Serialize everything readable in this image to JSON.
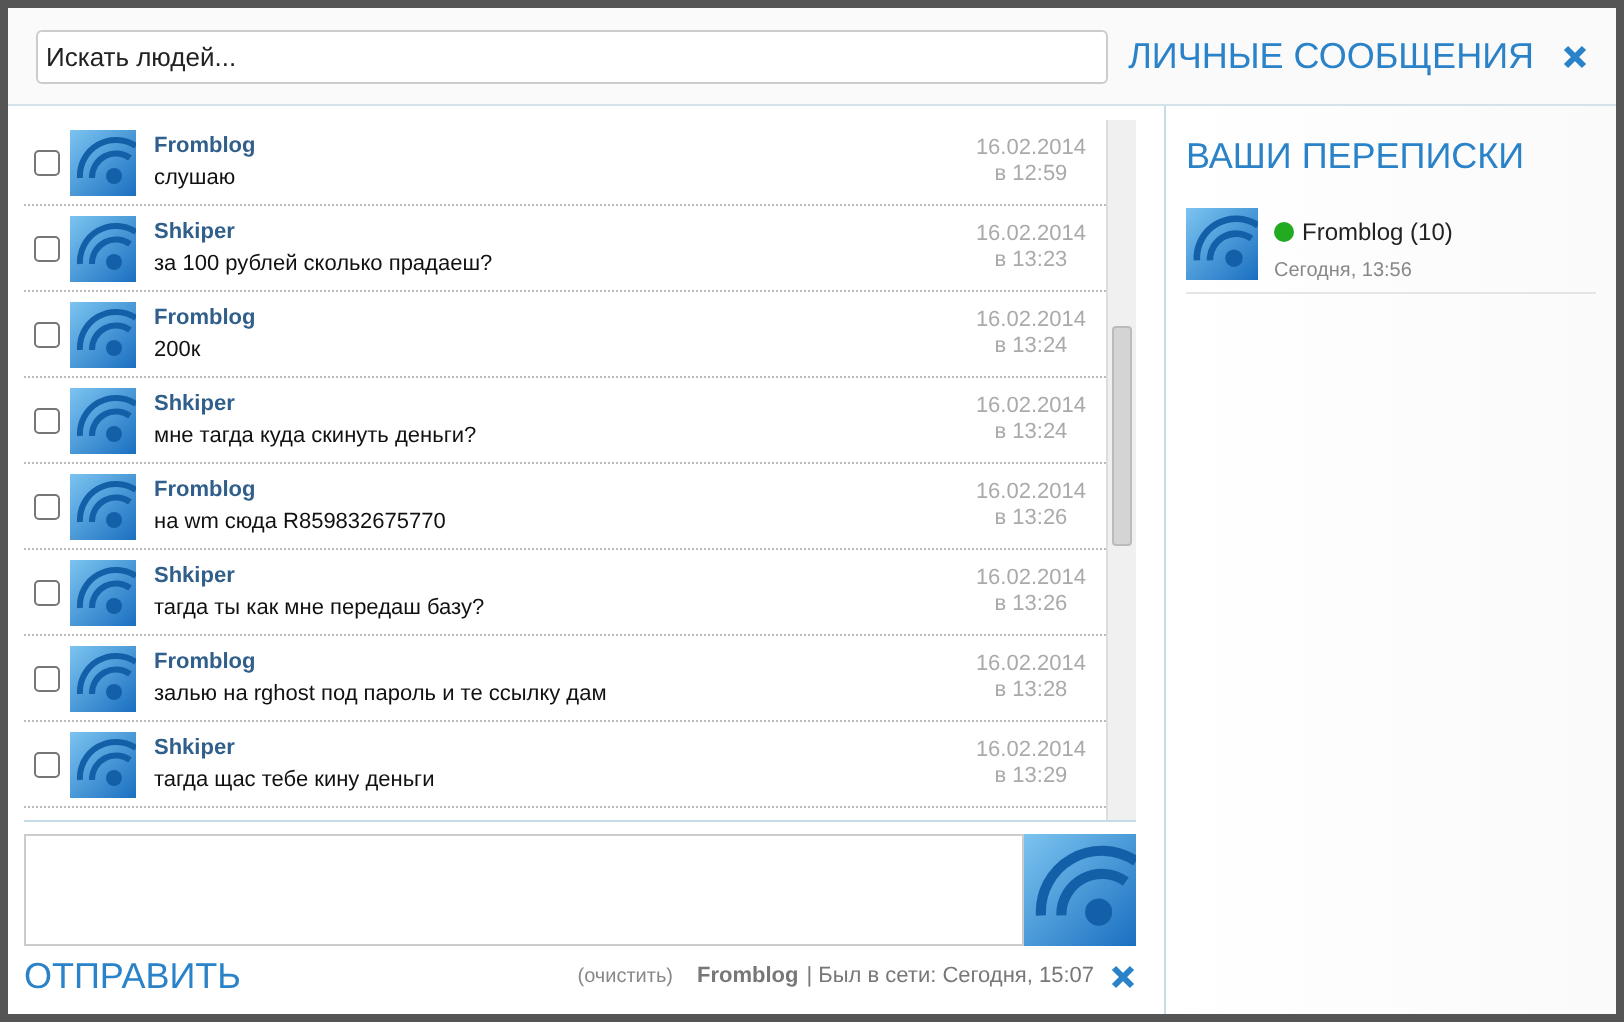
{
  "search": {
    "placeholder": "Искать людей..."
  },
  "title": "ЛИЧНЫЕ СООБЩЕНИЯ",
  "messages": [
    {
      "author": "Fromblog",
      "text": "слушаю",
      "date": "16.02.2014",
      "time": "в 12:59",
      "checked": false
    },
    {
      "author": "Shkiper",
      "text": "за 100 рублей сколько прадаеш?",
      "date": "16.02.2014",
      "time": "в 13:23",
      "checked": false
    },
    {
      "author": "Fromblog",
      "text": "200к",
      "date": "16.02.2014",
      "time": "в 13:24",
      "checked": false
    },
    {
      "author": "Shkiper",
      "text": "мне тагда куда скинуть деньги?",
      "date": "16.02.2014",
      "time": "в 13:24",
      "checked": false
    },
    {
      "author": "Fromblog",
      "text": "на wm сюда R859832675770",
      "date": "16.02.2014",
      "time": "в 13:26",
      "checked": false
    },
    {
      "author": "Shkiper",
      "text": "тагда ты как мне передаш базу?",
      "date": "16.02.2014",
      "time": "в 13:26",
      "checked": false
    },
    {
      "author": "Fromblog",
      "text": "залью на rghost под пароль и те ссылку дам",
      "date": "16.02.2014",
      "time": "в 13:28",
      "checked": false
    },
    {
      "author": "Shkiper",
      "text": "тагда щас тебе кину деньги",
      "date": "16.02.2014",
      "time": "в 13:29",
      "checked": false
    }
  ],
  "composer": {
    "send": "ОТПРАВИТЬ",
    "clear": "(очистить)",
    "contact": "Fromblog",
    "status": "| Был в сети: Сегодня, 15:07"
  },
  "conversations": {
    "title": "ВАШИ ПЕРЕПИСКИ",
    "items": [
      {
        "name": "Fromblog (10)",
        "time": "Сегодня, 13:56",
        "online": true,
        "selected": false
      }
    ]
  }
}
